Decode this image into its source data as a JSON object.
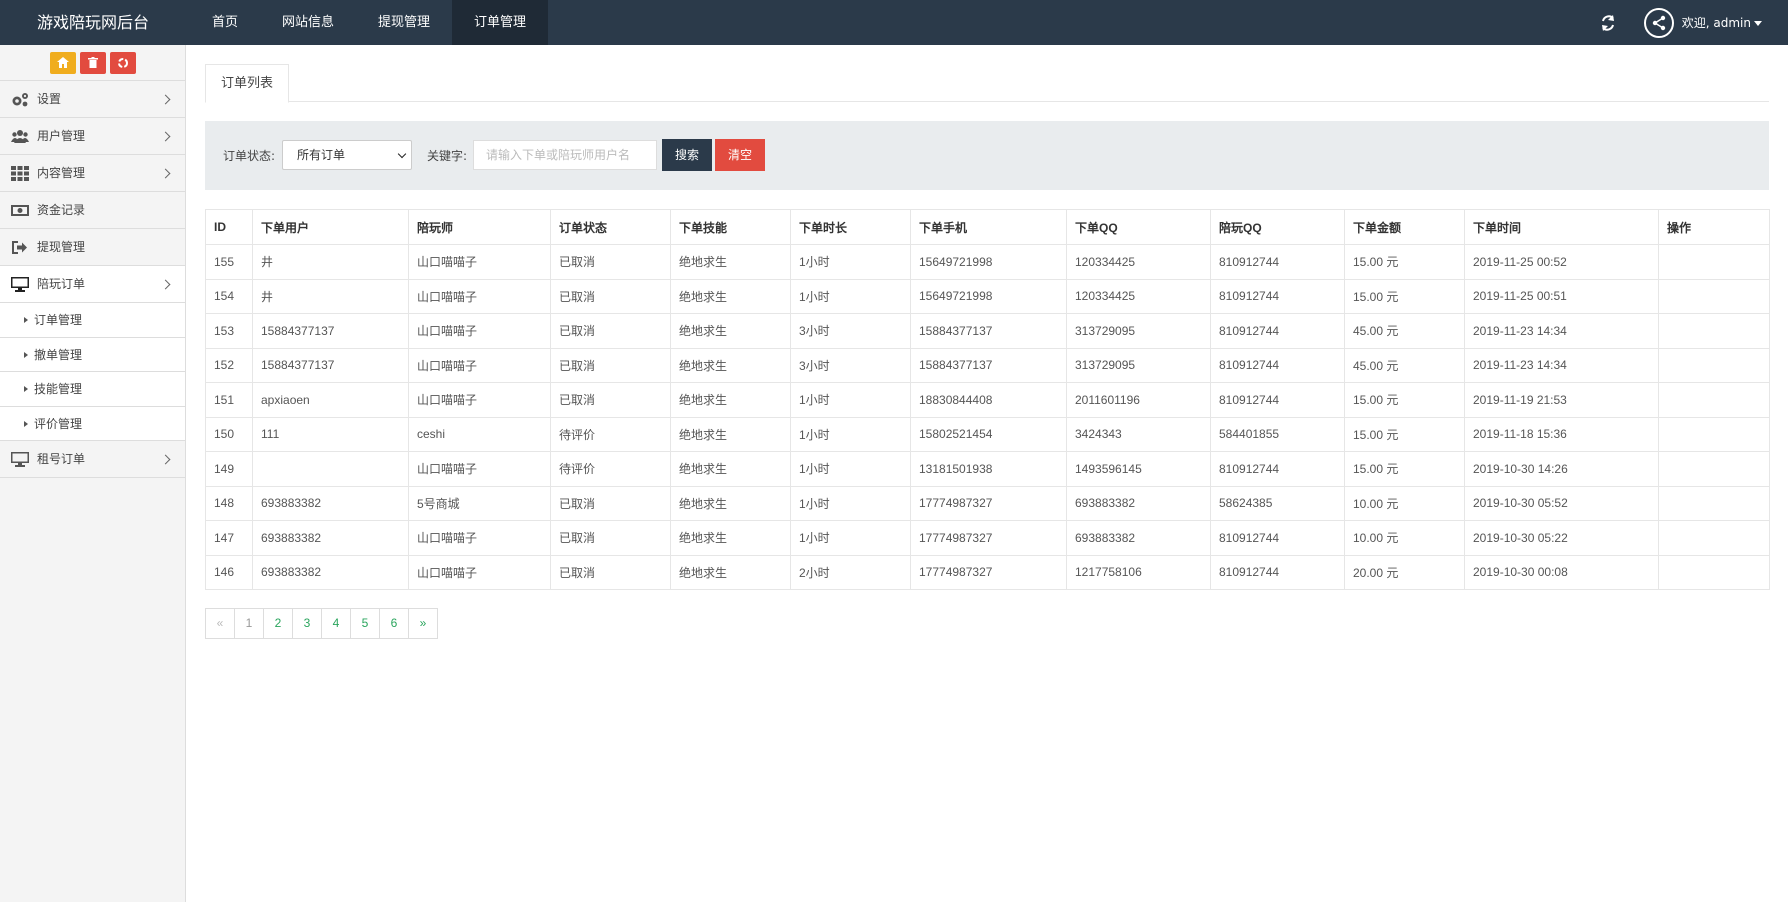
{
  "header": {
    "brand": "游戏陪玩网后台",
    "nav": [
      "首页",
      "网站信息",
      "提现管理",
      "订单管理"
    ],
    "active_nav": 3,
    "welcome": "欢迎, admin"
  },
  "sidebar": {
    "quick_buttons": [
      {
        "icon": "home-icon",
        "color": "#f0ad1e"
      },
      {
        "icon": "trash-icon",
        "color": "#e24b3f"
      },
      {
        "icon": "recycle-icon",
        "color": "#e24b3f"
      }
    ],
    "items": [
      {
        "label": "设置",
        "icon": "gears-icon",
        "has_children": true
      },
      {
        "label": "用户管理",
        "icon": "users-icon",
        "has_children": true
      },
      {
        "label": "内容管理",
        "icon": "grid-icon",
        "has_children": true
      },
      {
        "label": "资金记录",
        "icon": "money-icon",
        "has_children": false
      },
      {
        "label": "提现管理",
        "icon": "sign-out-icon",
        "has_children": false
      },
      {
        "label": "陪玩订单",
        "icon": "monitor-icon",
        "has_children": true,
        "open": true
      },
      {
        "label": "租号订单",
        "icon": "monitor-icon",
        "has_children": true
      }
    ],
    "sub_items": [
      "订单管理",
      "撤单管理",
      "技能管理",
      "评价管理"
    ]
  },
  "main": {
    "tab": "订单列表",
    "filter": {
      "status_label": "订单状态:",
      "status_value": "所有订单",
      "keyword_label": "关键字:",
      "keyword_placeholder": "请输入下单或陪玩师用户名",
      "search_label": "搜索",
      "clear_label": "清空"
    },
    "table": {
      "columns": [
        "ID",
        "下单用户",
        "陪玩师",
        "订单状态",
        "下单技能",
        "下单时长",
        "下单手机",
        "下单QQ",
        "陪玩QQ",
        "下单金额",
        "下单时间",
        "操作"
      ],
      "rows": [
        [
          "155",
          "井",
          "山口喵喵子",
          "已取消",
          "绝地求生",
          "1小时",
          "15649721998",
          "120334425",
          "810912744",
          "15.00 元",
          "2019-11-25 00:52",
          ""
        ],
        [
          "154",
          "井",
          "山口喵喵子",
          "已取消",
          "绝地求生",
          "1小时",
          "15649721998",
          "120334425",
          "810912744",
          "15.00 元",
          "2019-11-25 00:51",
          ""
        ],
        [
          "153",
          "15884377137",
          "山口喵喵子",
          "已取消",
          "绝地求生",
          "3小时",
          "15884377137",
          "313729095",
          "810912744",
          "45.00 元",
          "2019-11-23 14:34",
          ""
        ],
        [
          "152",
          "15884377137",
          "山口喵喵子",
          "已取消",
          "绝地求生",
          "3小时",
          "15884377137",
          "313729095",
          "810912744",
          "45.00 元",
          "2019-11-23 14:34",
          ""
        ],
        [
          "151",
          "apxiaoen",
          "山口喵喵子",
          "已取消",
          "绝地求生",
          "1小时",
          "18830844408",
          "2011601196",
          "810912744",
          "15.00 元",
          "2019-11-19 21:53",
          ""
        ],
        [
          "150",
          "111",
          "ceshi",
          "待评价",
          "绝地求生",
          "1小时",
          "15802521454",
          "3424343",
          "584401855",
          "15.00 元",
          "2019-11-18 15:36",
          ""
        ],
        [
          "149",
          "",
          "山口喵喵子",
          "待评价",
          "绝地求生",
          "1小时",
          "13181501938",
          "1493596145",
          "810912744",
          "15.00 元",
          "2019-10-30 14:26",
          ""
        ],
        [
          "148",
          "693883382",
          "5号商城",
          "已取消",
          "绝地求生",
          "1小时",
          "17774987327",
          "693883382",
          "58624385",
          "10.00 元",
          "2019-10-30 05:52",
          ""
        ],
        [
          "147",
          "693883382",
          "山口喵喵子",
          "已取消",
          "绝地求生",
          "1小时",
          "17774987327",
          "693883382",
          "810912744",
          "10.00 元",
          "2019-10-30 05:22",
          ""
        ],
        [
          "146",
          "693883382",
          "山口喵喵子",
          "已取消",
          "绝地求生",
          "2小时",
          "17774987327",
          "1217758106",
          "810912744",
          "20.00 元",
          "2019-10-30 00:08",
          ""
        ]
      ]
    },
    "pagination": [
      "«",
      "1",
      "2",
      "3",
      "4",
      "5",
      "6",
      "»"
    ],
    "current_page": "1"
  },
  "colors": {
    "header_bg": "#2b3a4a",
    "active_nav_bg": "#1f2a36",
    "search_btn": "#2b3a4a",
    "clear_btn": "#e24b3f",
    "pager_link": "#2aa55d"
  }
}
